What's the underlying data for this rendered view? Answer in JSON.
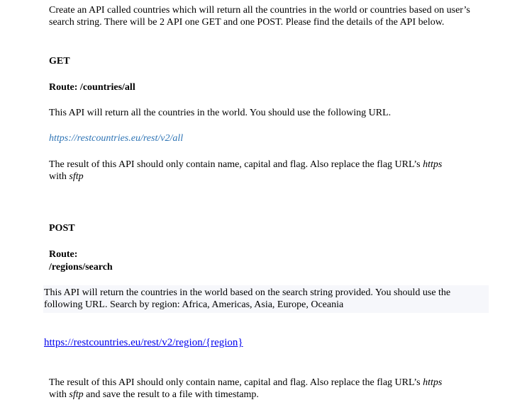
{
  "intro": {
    "text": "Create an API called countries which will return all the countries in the world or countries based on user’s search string. There will be 2 API one GET and one POST. Please find the details of the API below."
  },
  "get_section": {
    "heading": "GET",
    "route": "Route: /countries/all",
    "description": "This API will return all the countries in the world. You should use the following URL.",
    "url": "https://restcountries.eu/rest/v2/all",
    "result_text_a": "The result of this API should only contain name, capital and flag. Also replace the flag URL’s ",
    "result_https": "https",
    "result_text_b": " with ",
    "result_sftp": "sftp"
  },
  "post_section": {
    "heading": "POST",
    "route_label": "Route:",
    "route_path": "/regions/search",
    "description": "This API will return the countries in the world based on the search string provided. You should use the following URL. Search by region: Africa, Americas, Asia, Europe, Oceania",
    "url": "https://restcountries.eu/rest/v2/region/{region}",
    "result_text_a": "The result of this API should only contain name, capital and flag. Also replace the flag URL’s ",
    "result_https": "https",
    "result_text_b": " with ",
    "result_sftp": "sftp",
    "result_text_c": " and save the result to a file with timestamp."
  }
}
